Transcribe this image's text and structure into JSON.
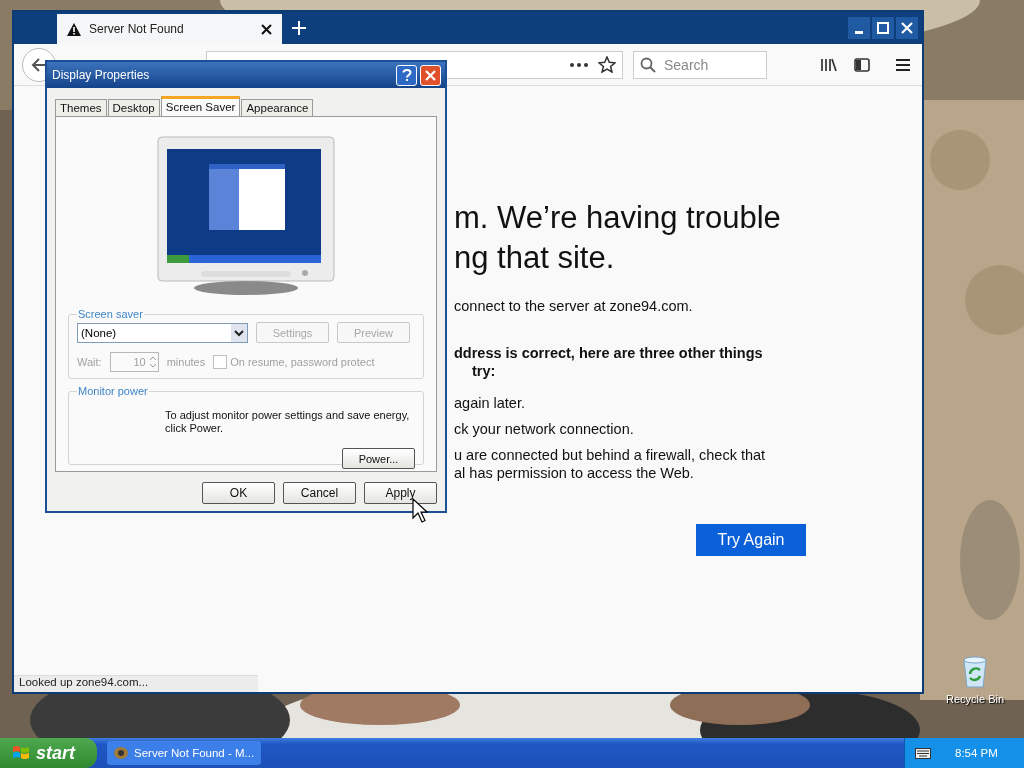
{
  "browser": {
    "tab": {
      "title": "Server Not Found",
      "selected": true
    },
    "search": {
      "placeholder": "Search"
    },
    "error": {
      "title_lines": [
        "m. We’re having trouble",
        "ng that site."
      ],
      "message": "connect to the server at zone94.com.",
      "subheading_lines": [
        "ddress is correct, here are three other things",
        "try:"
      ],
      "suggestions": [
        "again later.",
        "ck your network connection.",
        "u are connected but behind a firewall, check that\nal has permission to access the Web."
      ],
      "button": "Try Again"
    },
    "status_bar": "Looked up zone94.com..."
  },
  "dialog": {
    "title": "Display Properties",
    "tabs": [
      {
        "label": "Themes",
        "selected": false
      },
      {
        "label": "Desktop",
        "selected": false
      },
      {
        "label": "Screen Saver",
        "selected": true
      },
      {
        "label": "Appearance",
        "selected": false
      }
    ],
    "screen_saver": {
      "legend": "Screen saver",
      "value": "(None)",
      "buttons": [
        {
          "label": "Settings",
          "disabled": true
        },
        {
          "label": "Preview",
          "disabled": true
        }
      ],
      "wait": {
        "label": "Wait:",
        "value": "10",
        "unit": "minutes",
        "disabled": true
      },
      "password_protect": {
        "label": "On resume, password protect",
        "checked": false,
        "disabled": true
      }
    },
    "monitor_power": {
      "legend": "Monitor power",
      "text": "To adjust monitor power settings and save energy, click Power.",
      "button": "Power..."
    },
    "buttons": [
      "OK",
      "Cancel",
      "Apply"
    ]
  },
  "desktop": {
    "icons": [
      {
        "label": "Recycle Bin"
      }
    ]
  },
  "taskbar": {
    "start": "start",
    "tasks": [
      {
        "label": "Server Not Found - M...",
        "selected": false
      }
    ],
    "clock": "8:54 PM"
  }
}
